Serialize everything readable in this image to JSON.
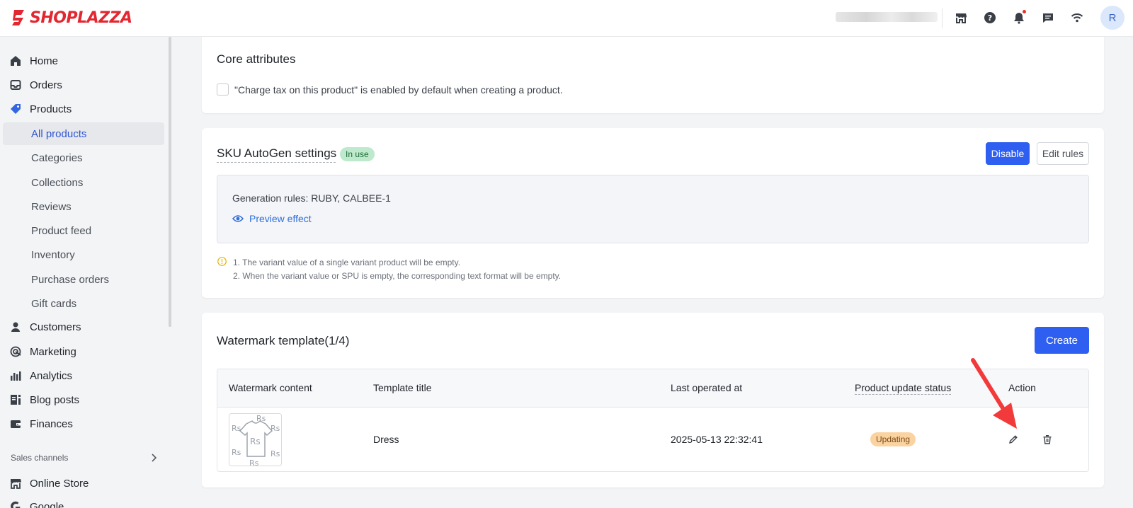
{
  "brand": {
    "name": "SHOPLAZZA",
    "color": "#e3262f"
  },
  "topbar": {
    "icons": [
      "store-icon",
      "help-icon",
      "bell-icon",
      "chat-icon",
      "wifi-icon"
    ],
    "avatar_initial": "R"
  },
  "sidebar": {
    "items": [
      {
        "label": "Home",
        "icon": "home-icon"
      },
      {
        "label": "Orders",
        "icon": "inbox-icon"
      },
      {
        "label": "Products",
        "icon": "tag-icon"
      },
      {
        "label": "Customers",
        "icon": "person-icon"
      },
      {
        "label": "Marketing",
        "icon": "target-icon"
      },
      {
        "label": "Analytics",
        "icon": "bar-chart-icon"
      },
      {
        "label": "Blog posts",
        "icon": "blog-icon"
      },
      {
        "label": "Finances",
        "icon": "wallet-icon"
      },
      {
        "label": "Online Store",
        "icon": "storefront-icon"
      },
      {
        "label": "Google",
        "icon": "google-icon"
      }
    ],
    "products_sub": [
      {
        "label": "All products",
        "active": true
      },
      {
        "label": "Categories"
      },
      {
        "label": "Collections"
      },
      {
        "label": "Reviews"
      },
      {
        "label": "Product feed"
      },
      {
        "label": "Inventory"
      },
      {
        "label": "Purchase orders"
      },
      {
        "label": "Gift cards"
      }
    ],
    "sales_channels_label": "Sales channels"
  },
  "core": {
    "title": "Core attributes",
    "checkbox_label": "\"Charge tax on this product\" is enabled by default when creating a product.",
    "checked": false
  },
  "sku": {
    "title": "SKU AutoGen settings",
    "status": "In use",
    "disable_label": "Disable",
    "edit_rules_label": "Edit rules",
    "rules_label": "Generation rules:  RUBY, CALBEE-1",
    "preview_label": "Preview effect",
    "notes": [
      "1. The variant value of a single variant product will be empty.",
      "2. When the variant value or SPU is empty, the corresponding text format will be empty."
    ]
  },
  "watermark": {
    "title": "Watermark template(1/4)",
    "create_label": "Create",
    "columns": [
      "Watermark content",
      "Template title",
      "Last operated at",
      "Product update status",
      "Action"
    ],
    "rows": [
      {
        "template_title": "Dress",
        "last_operated": "2025-05-13 22:32:41",
        "status": "Updating",
        "thumb_text": "Rs"
      }
    ]
  },
  "colors": {
    "primary": "#2f5ff0",
    "link": "#2f6fd8",
    "in_use_bg": "#bfe9cc",
    "updating_bg": "#fbd3a0",
    "arrow": "#f23a3a"
  }
}
